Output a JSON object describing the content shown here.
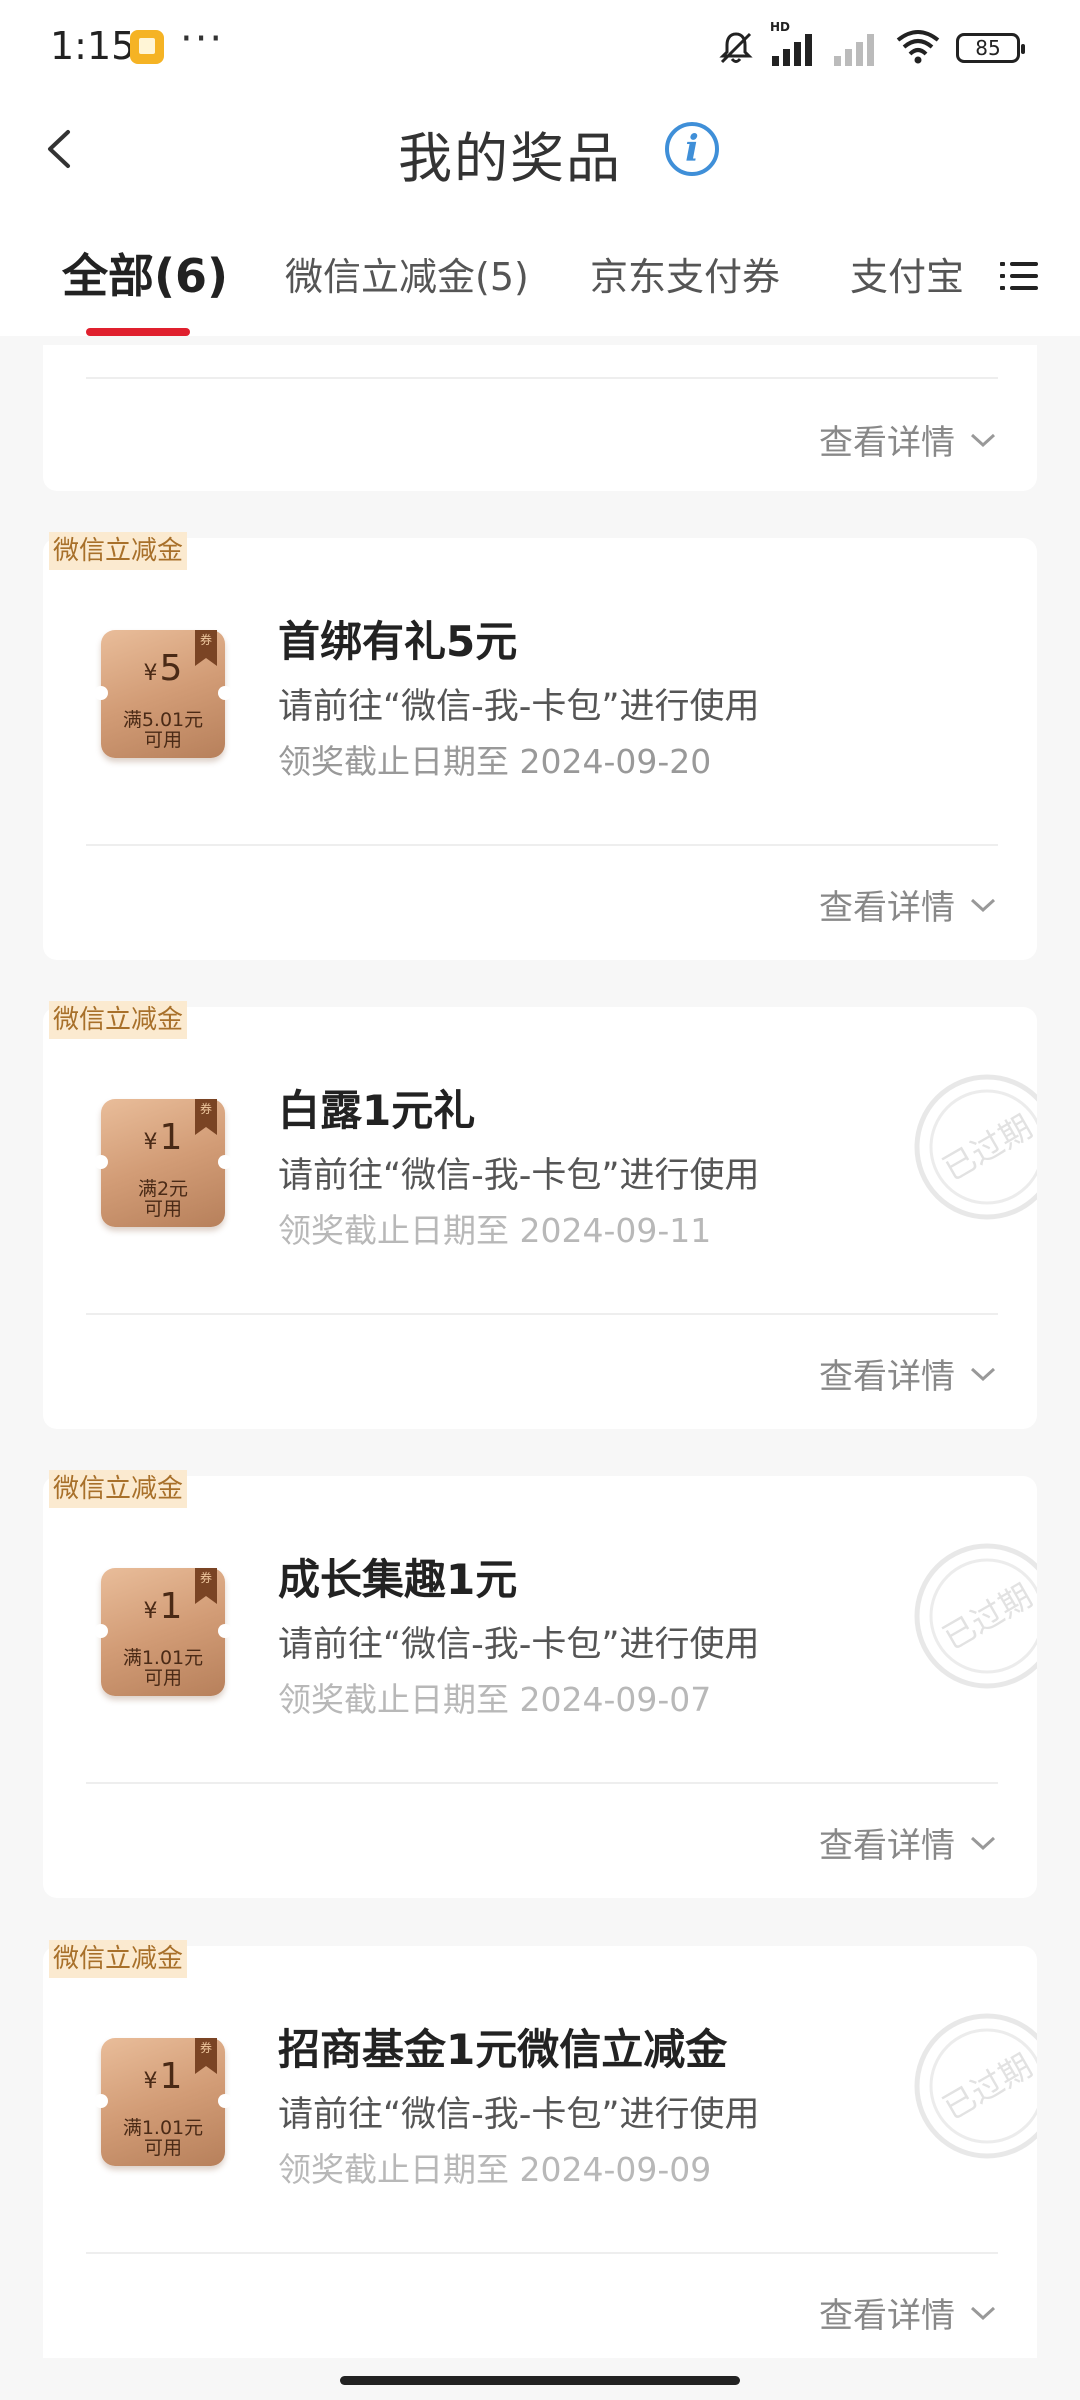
{
  "status_bar": {
    "time": "1:15",
    "dots": "···",
    "battery": "85",
    "icons": [
      "app-notification-icon",
      "mute-icon",
      "signal-hd-icon",
      "signal-icon",
      "wifi-icon",
      "battery-icon"
    ]
  },
  "header": {
    "title": "我的奖品",
    "info_icon": "i"
  },
  "tabs": [
    {
      "label": "全部(6)",
      "active": true
    },
    {
      "label": "微信立减金(5)",
      "active": false
    },
    {
      "label": "京东支付券",
      "active": false
    },
    {
      "label": "支付宝",
      "active": false
    }
  ],
  "accent_color": "#e0202e",
  "first_card": {
    "detail_label": "查看详情"
  },
  "cards": [
    {
      "badge": "微信立减金",
      "coupon": {
        "currency": "¥",
        "amount": "5",
        "condition_line1": "满5.01元",
        "condition_line2": "可用",
        "tag": "券"
      },
      "name": "首绑有礼5元",
      "desc": "请前往“微信-我-卡包”进行使用",
      "date": "领奖截止日期至 2024-09-20",
      "detail_label": "查看详情",
      "expired": false
    },
    {
      "badge": "微信立减金",
      "coupon": {
        "currency": "¥",
        "amount": "1",
        "condition_line1": "满2元",
        "condition_line2": "可用",
        "tag": "券"
      },
      "name": "白露1元礼",
      "desc": "请前往“微信-我-卡包”进行使用",
      "date": "领奖截止日期至 2024-09-11",
      "detail_label": "查看详情",
      "expired": true,
      "stamp": "已过期"
    },
    {
      "badge": "微信立减金",
      "coupon": {
        "currency": "¥",
        "amount": "1",
        "condition_line1": "满1.01元",
        "condition_line2": "可用",
        "tag": "券"
      },
      "name": "成长集趣1元",
      "desc": "请前往“微信-我-卡包”进行使用",
      "date": "领奖截止日期至 2024-09-07",
      "detail_label": "查看详情",
      "expired": true,
      "stamp": "已过期"
    },
    {
      "badge": "微信立减金",
      "coupon": {
        "currency": "¥",
        "amount": "1",
        "condition_line1": "满1.01元",
        "condition_line2": "可用",
        "tag": "券"
      },
      "name": "招商基金1元微信立减金",
      "desc": "请前往“微信-我-卡包”进行使用",
      "date": "领奖截止日期至 2024-09-09",
      "detail_label": "查看详情",
      "expired": true,
      "stamp": "已过期"
    }
  ]
}
